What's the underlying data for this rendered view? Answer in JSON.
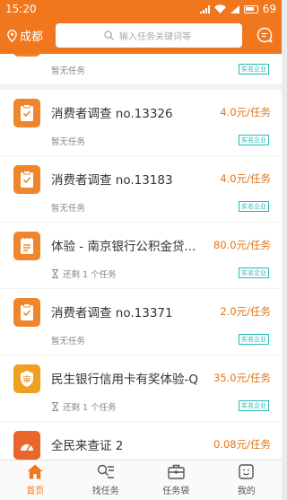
{
  "status_bar": {
    "time": "15:20",
    "battery": "69"
  },
  "header": {
    "city": "成都",
    "search_placeholder": "输入任务关键词等"
  },
  "tasks": [
    {
      "title": "",
      "price": "",
      "sub": "暂无任务",
      "badge": "实名企业",
      "icon": "clipboard-icon"
    },
    {
      "title": "消费者调查 no.13326",
      "price": "4.0元/任务",
      "sub": "暂无任务",
      "badge": "实名企业",
      "icon": "clipboard-icon"
    },
    {
      "title": "消费者调查 no.13183",
      "price": "4.0元/任务",
      "sub": "暂无任务",
      "badge": "实名企业",
      "icon": "clipboard-icon"
    },
    {
      "title": "体验 - 南京银行公积金贷...",
      "price": "80.0元/任务",
      "sub": "还剩 1 个任务",
      "badge": "实名企业",
      "icon": "notepad-icon"
    },
    {
      "title": "消费者调查 no.13371",
      "price": "2.0元/任务",
      "sub": "暂无任务",
      "badge": "实名企业",
      "icon": "clipboard-icon"
    },
    {
      "title": "民生银行信用卡有奖体验-Q",
      "price": "35.0元/任务",
      "sub": "还剩 1 个任务",
      "badge": "实名企业",
      "icon": "shield-icon"
    },
    {
      "title": "全民来查证 2",
      "price": "0.08元/任务",
      "sub": "",
      "badge": "",
      "icon": "gauge-icon"
    }
  ],
  "tabs": [
    {
      "label": "首页",
      "icon": "home-icon",
      "active": true
    },
    {
      "label": "找任务",
      "icon": "task-search-icon",
      "active": false
    },
    {
      "label": "任务袋",
      "icon": "briefcase-icon",
      "active": false
    },
    {
      "label": "我的",
      "icon": "profile-icon",
      "active": false
    }
  ],
  "colors": {
    "brand": "#f0771e",
    "price": "#e0761c",
    "badge": "#2ab8b2"
  }
}
